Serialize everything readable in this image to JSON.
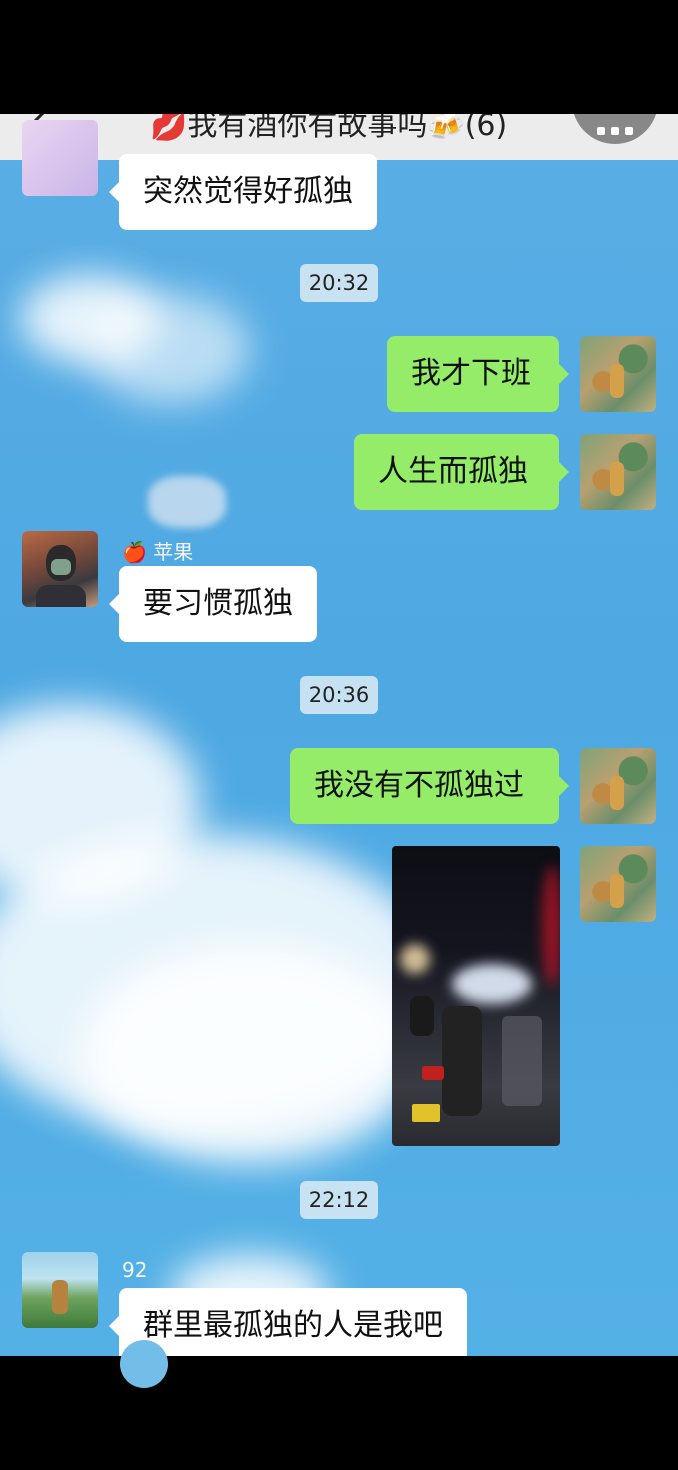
{
  "header": {
    "title": "💋我有酒你有故事吗🍻(6)",
    "back_icon": "chevron-left-icon",
    "more_icon": "more-icon"
  },
  "messages": [
    {
      "side": "left",
      "text": "突然觉得好孤独"
    },
    {
      "type": "time",
      "text": "20:32"
    },
    {
      "side": "right",
      "text": "我才下班"
    },
    {
      "side": "right",
      "text": "人生而孤独"
    },
    {
      "side": "left",
      "sender": "🍎 苹果",
      "text": "要习惯孤独"
    },
    {
      "type": "time",
      "text": "20:36"
    },
    {
      "side": "right",
      "text": "我没有不孤独过"
    },
    {
      "side": "right",
      "type": "image",
      "image": "night-street-motorcycles-photo"
    },
    {
      "type": "time",
      "text": "22:12"
    },
    {
      "side": "left",
      "sender": "92",
      "text": "群里最孤独的人是我吧"
    }
  ],
  "colors": {
    "my_bubble": "#95ec69",
    "their_bubble": "#ffffff",
    "chat_background": "#4ea8e2"
  }
}
